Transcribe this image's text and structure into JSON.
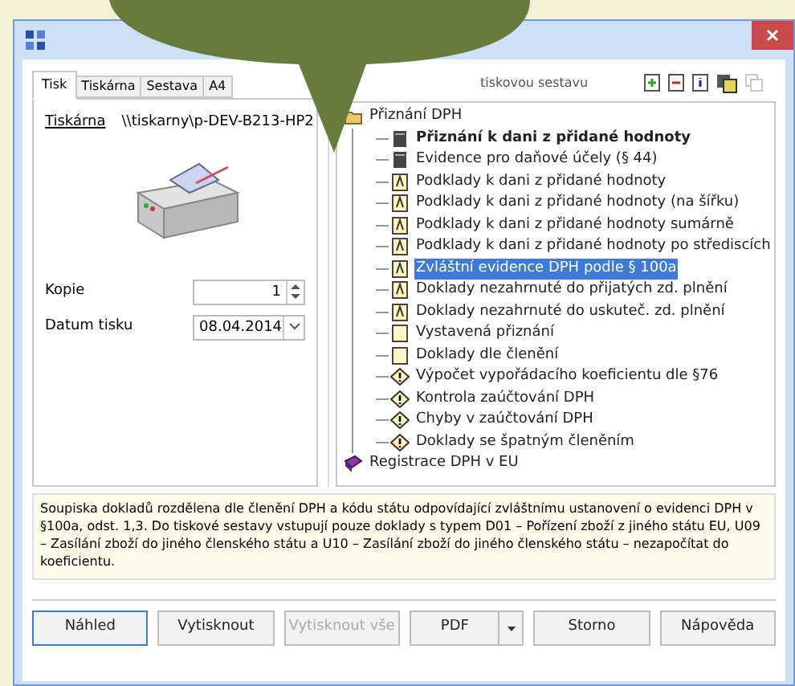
{
  "tabs": [
    {
      "label": "Tisk",
      "selected": true
    },
    {
      "label": "Tiskárna",
      "selected": false
    },
    {
      "label": "Sestava",
      "selected": false
    },
    {
      "label": "A4",
      "selected": false
    }
  ],
  "printer": {
    "label": "Tiskárna",
    "value": "\\\\tiskarny\\p-DEV-B213-HP2"
  },
  "copies": {
    "label": "Kopie",
    "value": "1"
  },
  "print_date": {
    "label": "Datum tisku",
    "value": "08.04.2014"
  },
  "report_hint": "tiskovou sestavu",
  "tree": [
    {
      "label": "Přiznání DPH",
      "kind": "folder",
      "selected": false,
      "bold": false,
      "children": [
        {
          "label": "Přiznání k dani z přidané hodnoty",
          "kind": "form",
          "selected": false,
          "bold": true
        },
        {
          "label": "Evidence pro daňové účely (§ 44)",
          "kind": "form",
          "selected": false,
          "bold": false
        },
        {
          "label": "Podklady k dani z přidané hodnoty",
          "kind": "report",
          "selected": false,
          "bold": false
        },
        {
          "label": "Podklady k dani z přidané hodnoty (na šířku)",
          "kind": "report",
          "selected": false,
          "bold": false
        },
        {
          "label": "Podklady k dani z přidané hodnoty sumárně",
          "kind": "report",
          "selected": false,
          "bold": false
        },
        {
          "label": "Podklady k dani z přidané hodnoty po střediscích",
          "kind": "report",
          "selected": false,
          "bold": false
        },
        {
          "label": "Zvláštní evidence DPH podle § 100a",
          "kind": "report",
          "selected": true,
          "bold": false
        },
        {
          "label": "Doklady nezahrnuté do přijatých zd. plnění",
          "kind": "report",
          "selected": false,
          "bold": false
        },
        {
          "label": "Doklady nezahrnuté do uskuteč. zd. plnění",
          "kind": "report",
          "selected": false,
          "bold": false
        },
        {
          "label": "Vystavená přiznání",
          "kind": "page",
          "selected": false,
          "bold": false
        },
        {
          "label": "Doklady dle členění",
          "kind": "page",
          "selected": false,
          "bold": false
        },
        {
          "label": "Výpočet vypořádacího koeficientu dle §76",
          "kind": "check",
          "selected": false,
          "bold": false
        },
        {
          "label": "Kontrola zaúčtování DPH",
          "kind": "check",
          "selected": false,
          "bold": false
        },
        {
          "label": "Chyby v zaúčtování DPH",
          "kind": "check",
          "selected": false,
          "bold": false
        },
        {
          "label": "Doklady se špatným členěním",
          "kind": "check",
          "selected": false,
          "bold": false
        }
      ]
    },
    {
      "label": "Registrace DPH v EU",
      "kind": "book",
      "selected": false,
      "bold": false
    }
  ],
  "description": "Soupiska dokladů rozdělena dle členění DPH a kódu státu odpovídající zvláštnímu ustanovení o evidenci DPH v §100a, odst. 1,3. Do tiskové sestavy vstupují pouze doklady s typem D01 – Pořízení zboží z jiného státu EU, U09 – Zasílání zboží do jiného členského státu a U10 – Zasílání zboží do jiného členského státu – nezapočítat do koeficientu.",
  "buttons": [
    {
      "label": "Náhled",
      "kind": "plain",
      "selected": true,
      "disabled": false
    },
    {
      "label": "Vytisknout",
      "kind": "plain",
      "selected": false,
      "disabled": false
    },
    {
      "label": "Vytisknout vše",
      "kind": "plain",
      "selected": false,
      "disabled": true
    },
    {
      "label": "PDF",
      "kind": "split",
      "selected": false,
      "disabled": false
    },
    {
      "label": "Storno",
      "kind": "plain",
      "selected": false,
      "disabled": false
    },
    {
      "label": "Nápověda",
      "kind": "plain",
      "selected": false,
      "disabled": false
    }
  ]
}
